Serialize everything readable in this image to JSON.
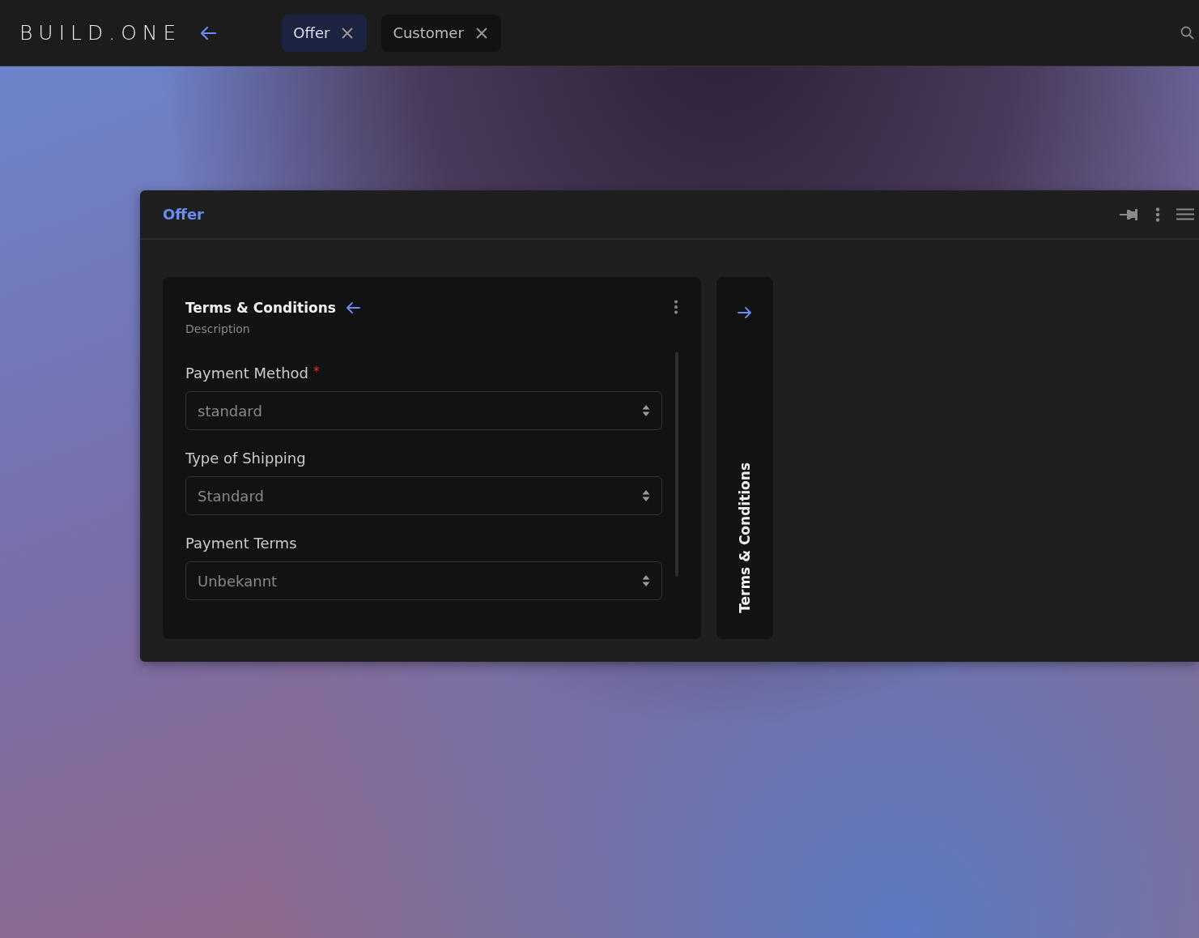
{
  "topbar": {
    "logo": "BUILD.ONE",
    "tabs": [
      {
        "label": "Offer",
        "selected": true
      },
      {
        "label": "Customer",
        "selected": false
      }
    ]
  },
  "panel": {
    "title": "Offer"
  },
  "card": {
    "title": "Terms & Conditions",
    "subtitle": "Description",
    "fields": [
      {
        "label": "Payment Method",
        "required_mark": "*",
        "value": "standard"
      },
      {
        "label": "Type of Shipping",
        "value": "Standard"
      },
      {
        "label": "Payment Terms",
        "value": "Unbekannt"
      }
    ]
  },
  "collapsed_card": {
    "title": "Terms & Conditions"
  }
}
